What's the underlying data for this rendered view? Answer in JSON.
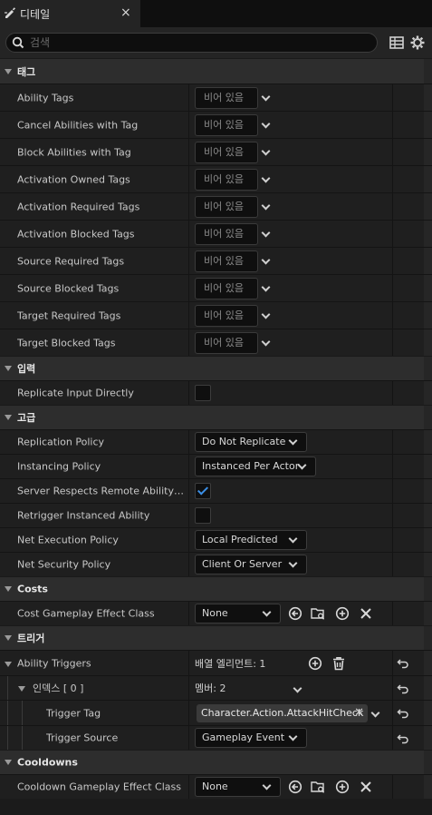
{
  "tab": {
    "title": "디테일",
    "close": "×"
  },
  "search": {
    "placeholder": "검색"
  },
  "sections": {
    "tags": {
      "label": "태그",
      "empty_label": "비어 있음",
      "rows": [
        "Ability Tags",
        "Cancel Abilities with Tag",
        "Block Abilities with Tag",
        "Activation Owned Tags",
        "Activation Required Tags",
        "Activation Blocked Tags",
        "Source Required Tags",
        "Source Blocked Tags",
        "Target Required Tags",
        "Target Blocked Tags"
      ]
    },
    "input": {
      "label": "입력",
      "replicate_input_directly": {
        "label": "Replicate Input Directly",
        "checked": false
      }
    },
    "advanced": {
      "label": "고급",
      "replication_policy": {
        "label": "Replication Policy",
        "value": "Do Not Replicate"
      },
      "instancing_policy": {
        "label": "Instancing Policy",
        "value": "Instanced Per Actor"
      },
      "server_respects": {
        "label": "Server Respects Remote Ability Cancellation",
        "checked": true
      },
      "retrigger": {
        "label": "Retrigger Instanced Ability",
        "checked": false
      },
      "net_execution_policy": {
        "label": "Net Execution Policy",
        "value": "Local Predicted"
      },
      "net_security_policy": {
        "label": "Net Security Policy",
        "value": "Client Or Server"
      }
    },
    "costs": {
      "label": "Costs",
      "cost_class": {
        "label": "Cost Gameplay Effect Class",
        "value": "None"
      }
    },
    "triggers": {
      "label": "트리거",
      "ability_triggers": {
        "label": "Ability Triggers",
        "value": "배열 엘리먼트: 1"
      },
      "index0": {
        "label": "인덱스 [ 0 ]",
        "value": "멤버: 2"
      },
      "trigger_tag": {
        "label": "Trigger Tag",
        "value": "Character.Action.AttackHitCheck"
      },
      "trigger_source": {
        "label": "Trigger Source",
        "value": "Gameplay Event"
      }
    },
    "cooldowns": {
      "label": "Cooldowns",
      "cooldown_class": {
        "label": "Cooldown Gameplay Effect Class",
        "value": "None"
      }
    }
  },
  "colors": {
    "accent_check": "#3b8fe6",
    "panel_bg": "#1f1f1f",
    "category_bg": "#2d2d2d"
  }
}
